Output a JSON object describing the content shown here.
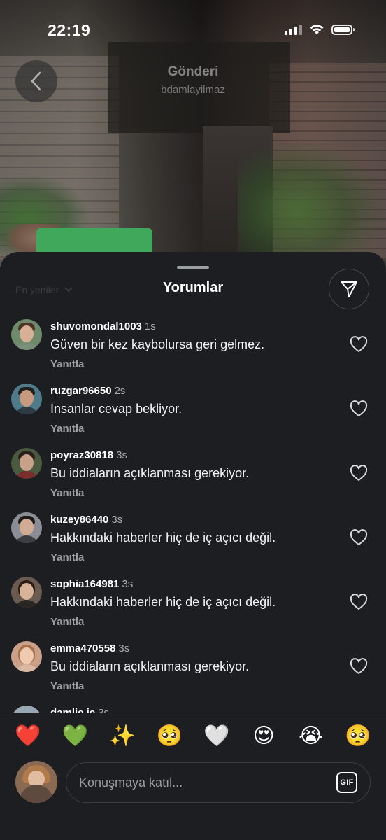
{
  "status_bar": {
    "time": "22:19"
  },
  "post_header": {
    "title": "Gönderi",
    "username": "bdamlayilmaz"
  },
  "comments_sheet": {
    "title": "Yorumlar",
    "sort_label": "En yeniler",
    "reply_label": "Yanıtla",
    "comments": [
      {
        "username": "shuvomondal1003",
        "time": "1s",
        "text": "Güven bir kez kaybolursa geri gelmez."
      },
      {
        "username": "ruzgar96650",
        "time": "2s",
        "text": "İnsanlar cevap bekliyor."
      },
      {
        "username": "poyraz30818",
        "time": "3s",
        "text": "Bu iddiaların açıklanması gerekiyor."
      },
      {
        "username": "kuzey86440",
        "time": "3s",
        "text": "Hakkındaki haberler hiç de iç açıcı değil."
      },
      {
        "username": "sophia164981",
        "time": "3s",
        "text": "Hakkındaki haberler hiç de iç açıcı değil."
      },
      {
        "username": "emma470558",
        "time": "3s",
        "text": "Bu iddiaların açıklanması gerekiyor."
      },
      {
        "username": "damlie.je",
        "time": "3s",
        "text": ""
      }
    ]
  },
  "emoji_bar": [
    "❤️",
    "💚",
    "✨",
    "🥺",
    "🤍",
    "😍",
    "😭",
    "🥺"
  ],
  "composer": {
    "placeholder": "Konuşmaya katıl...",
    "gif_label": "GIF"
  },
  "colors": {
    "sheet_bg": "#1c1e21",
    "secondary_text": "#9a9da2"
  }
}
